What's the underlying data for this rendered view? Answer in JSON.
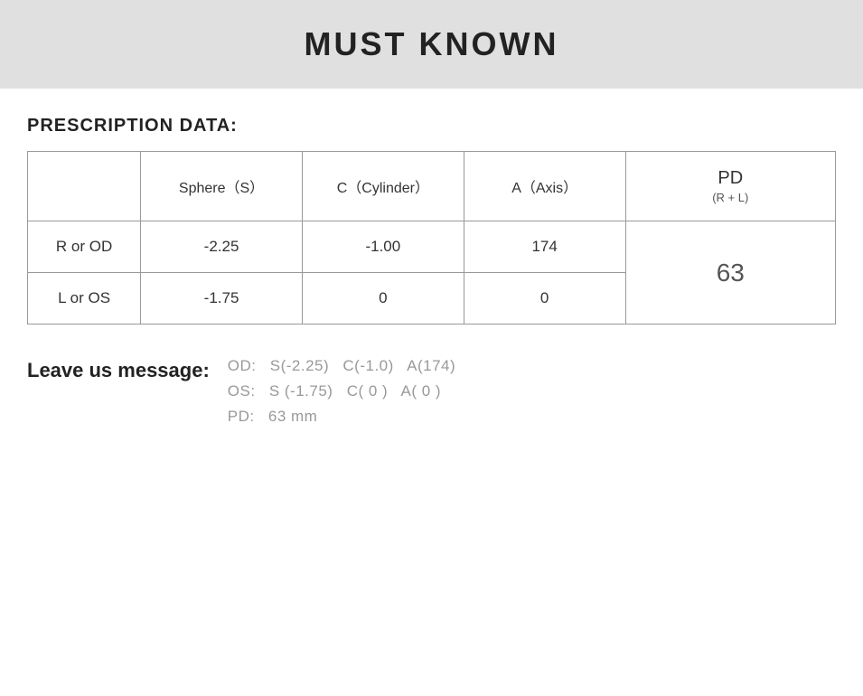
{
  "header": {
    "title": "MUST KNOWN"
  },
  "prescription": {
    "section_title": "PRESCRIPTION DATA:",
    "columns": {
      "col1": "",
      "sphere": "Sphere（S）",
      "cylinder": "C（Cylinder）",
      "axis": "A（Axis）",
      "pd": "PD",
      "pd_sub": "(R + L)"
    },
    "rows": [
      {
        "label": "R or OD",
        "sphere": "-2.25",
        "cylinder": "-1.00",
        "axis": "174"
      },
      {
        "label": "L or OS",
        "sphere": "-1.75",
        "cylinder": "0",
        "axis": "0"
      }
    ],
    "pd_value": "63"
  },
  "leave_message": {
    "label": "Leave us message:",
    "lines": [
      {
        "prefix": "OD:",
        "s": "S(-2.25)",
        "c": "C(-1.0)",
        "a": "A(174)"
      },
      {
        "prefix": "OS:",
        "s": "S (-1.75)",
        "c": "C( 0 )",
        "a": "A( 0 )"
      },
      {
        "prefix": "PD:",
        "value": "63 mm"
      }
    ]
  }
}
